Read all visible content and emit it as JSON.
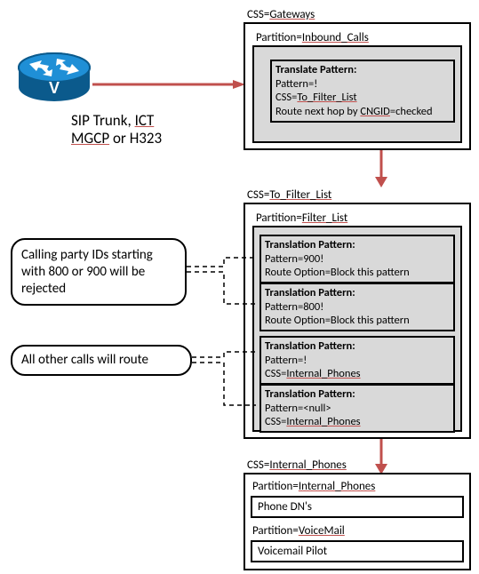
{
  "trunk": {
    "line1a": "SIP Trunk, ",
    "line1b": "ICT",
    "line2a": "MGCP",
    "line2b": " or H323"
  },
  "box1": {
    "css_label_a": "CSS=",
    "css_label_b": "Gateways",
    "partition_label_a": "Partition=",
    "partition_label_b": "Inbound_Calls",
    "pattern": {
      "title": "Translate Pattern:",
      "l1": "Pattern=!",
      "l2a": "CSS=",
      "l2b": "To_Filter_List",
      "l3a": "Route next hop by ",
      "l3b": "CNGID",
      "l3c": "=checked"
    }
  },
  "box2": {
    "css_label_a": "CSS=",
    "css_label_b": "To_Filter_List",
    "partition_label_a": "Partition=",
    "partition_label_b": "Filter_List",
    "p1": {
      "title": "Translation Pattern:",
      "l1": "Pattern=900!",
      "l2": "Route Option=Block this pattern"
    },
    "p2": {
      "title": "Translation Pattern:",
      "l1": "Pattern=800!",
      "l2": "Route Option=Block this pattern"
    },
    "p3": {
      "title": "Translation Pattern:",
      "l1": "Pattern=!",
      "l2a": "CSS=",
      "l2b": "Internal_Phones"
    },
    "p4": {
      "title": "Translation Pattern:",
      "l1": "Pattern=<null>",
      "l2a": "CSS=",
      "l2b": "Internal_Phones"
    }
  },
  "box3": {
    "css_label_a": "CSS=",
    "css_label_b": "Internal_Phones",
    "partition1_label_a": "Partition=",
    "partition1_label_b": "Internal_Phones",
    "content1": "Phone DN's",
    "partition2_label_a": "Partition=",
    "partition2_label_b": "VoiceMail",
    "content2": "Voicemail Pilot"
  },
  "speech1": "Calling party IDs starting with 800 or 900 will be rejected",
  "speech2": "All other calls will route",
  "router": {
    "glyph": "V"
  },
  "colors": {
    "arrow": "#c0504d",
    "router1": "#1f8fd6",
    "router2": "#0b5a8c"
  }
}
